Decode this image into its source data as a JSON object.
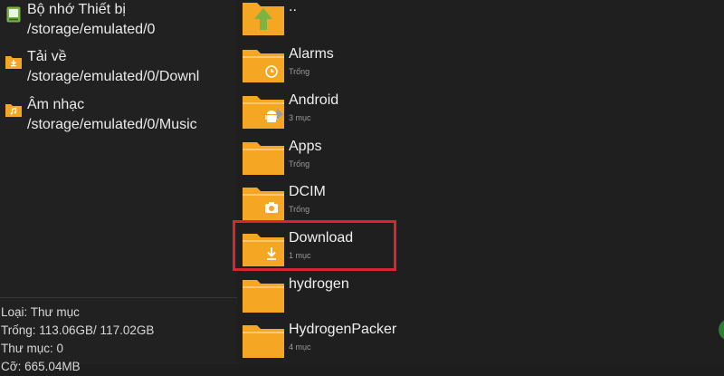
{
  "bookmarks": [
    {
      "title": "Bộ nhớ Thiết bị",
      "path": "/storage/emulated/0",
      "icon": "storage-icon"
    },
    {
      "title": "Tải về",
      "path": "/storage/emulated/0/Downl",
      "icon": "download-folder-icon"
    },
    {
      "title": "Âm nhạc",
      "path": "/storage/emulated/0/Music",
      "icon": "music-folder-icon"
    }
  ],
  "details": {
    "type": "Loại: Thư mục",
    "free": "Trống: 113.06GB/ 117.02GB",
    "folders": "Thư mục: 0",
    "size": "Cỡ: 665.04MB"
  },
  "files": [
    {
      "name": "..",
      "sub": "",
      "icon": "up-arrow-icon"
    },
    {
      "name": "Alarms",
      "sub": "Trống",
      "icon": "alarm-icon"
    },
    {
      "name": "Android",
      "sub": "3 mục",
      "icon": "android-icon"
    },
    {
      "name": "Apps",
      "sub": "Trống",
      "icon": "none"
    },
    {
      "name": "DCIM",
      "sub": "Trống",
      "icon": "camera-icon"
    },
    {
      "name": "Download",
      "sub": "1 mục",
      "icon": "download-icon"
    },
    {
      "name": "hydrogen",
      "sub": "",
      "icon": "none"
    },
    {
      "name": "HydrogenPacker",
      "sub": "4 mục",
      "icon": "none"
    }
  ],
  "colors": {
    "folder": "#f5a623",
    "highlight": "#d9252d",
    "background": "#1e1e1e"
  }
}
